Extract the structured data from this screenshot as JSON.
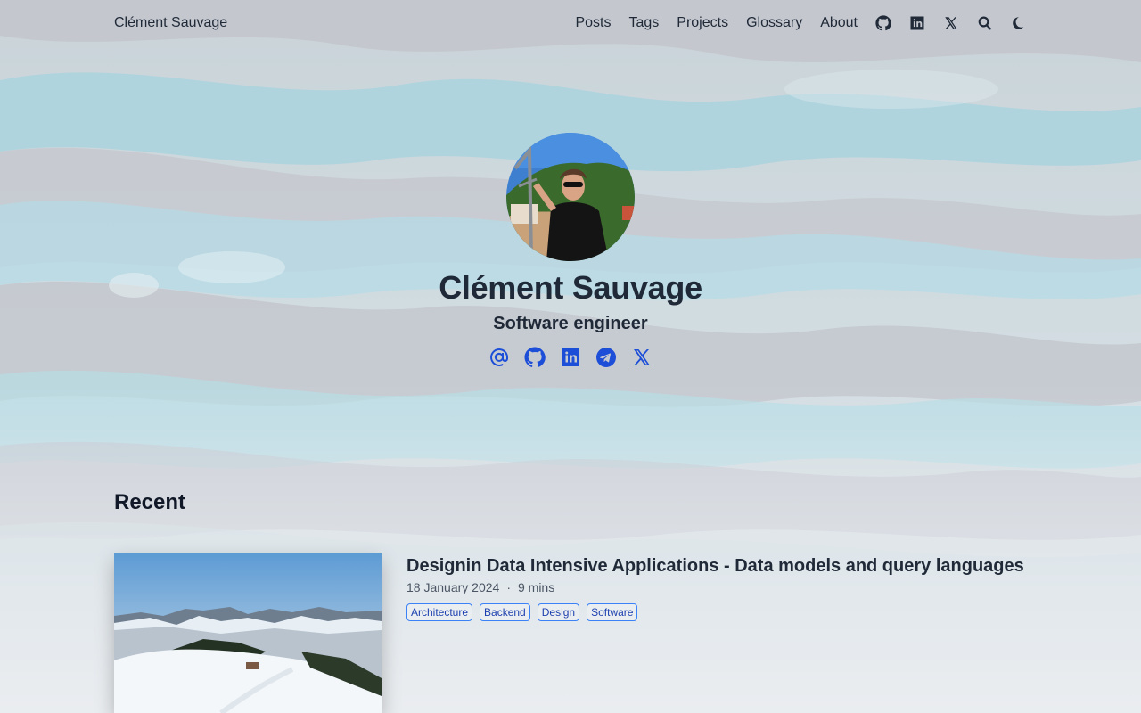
{
  "header": {
    "brand": "Clément Sauvage",
    "nav": [
      "Posts",
      "Tags",
      "Projects",
      "Glossary",
      "About"
    ],
    "icons": [
      "github-icon",
      "linkedin-icon",
      "x-icon",
      "search-icon",
      "moon-icon"
    ]
  },
  "hero": {
    "name": "Clément Sauvage",
    "subtitle": "Software engineer",
    "socials": [
      "email-icon",
      "github-icon",
      "linkedin-icon",
      "telegram-icon",
      "x-icon"
    ],
    "accent": "#1d4ed8"
  },
  "recent": {
    "heading": "Recent",
    "posts": [
      {
        "title": "Designin Data Intensive Applications - Data models and query languages",
        "date": "18 January 2024",
        "separator": "·",
        "read_time": "9 mins",
        "tags": [
          "Architecture",
          "Backend",
          "Design",
          "Software"
        ]
      }
    ]
  }
}
